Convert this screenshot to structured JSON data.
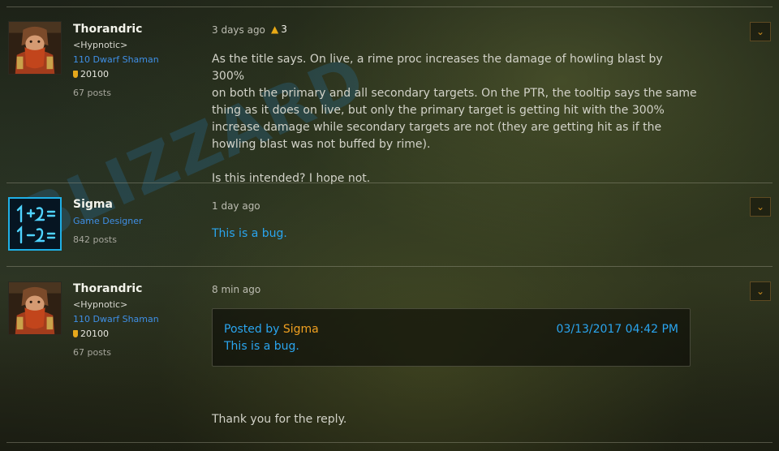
{
  "watermark": {
    "text": "BLIZZARD"
  },
  "posts": [
    {
      "author": {
        "name": "Thorandric",
        "guild": "<Hypnotic>",
        "class_line": "110 Dwarf Shaman",
        "achievement_points": "20100",
        "post_count": "67 posts",
        "avatar_icon": "dwarf-avatar-icon"
      },
      "timestamp": "3 days ago",
      "likes": "3",
      "body_lines": [
        "As the title says. On live, a rime proc increases the damage of howling blast by 300%",
        "on both the primary and all secondary targets. On the PTR, the tooltip says the same",
        "thing as it does on live, but only the primary target is getting hit with the 300%",
        "increase damage while secondary targets are not (they are getting hit as if the",
        "howling blast was not buffed by rime)."
      ],
      "body_footer": "Is this intended? I hope not."
    },
    {
      "author": {
        "name": "Sigma",
        "title": "Game Designer",
        "post_count": "842 posts",
        "avatar_icon": "blue-formula-avatar-icon"
      },
      "timestamp": "1 day ago",
      "body": "This is a bug."
    },
    {
      "author": {
        "name": "Thorandric",
        "guild": "<Hypnotic>",
        "class_line": "110 Dwarf Shaman",
        "achievement_points": "20100",
        "post_count": "67 posts",
        "avatar_icon": "dwarf-avatar-icon"
      },
      "timestamp": "8 min ago",
      "quote": {
        "prefix": "Posted by ",
        "author": "Sigma",
        "date": "03/13/2017 04:42 PM",
        "text": "This is a bug."
      },
      "body": "Thank you for the reply."
    }
  ],
  "icons": {
    "menu": "chevron-down-icon",
    "like": "thumbs-up-icon",
    "points": "shield-icon"
  },
  "colors": {
    "accent_blue": "#2aa5ef",
    "blizzard_title": "#3f8fe6",
    "gold": "#e8a916",
    "orange_name": "#f0a020"
  }
}
